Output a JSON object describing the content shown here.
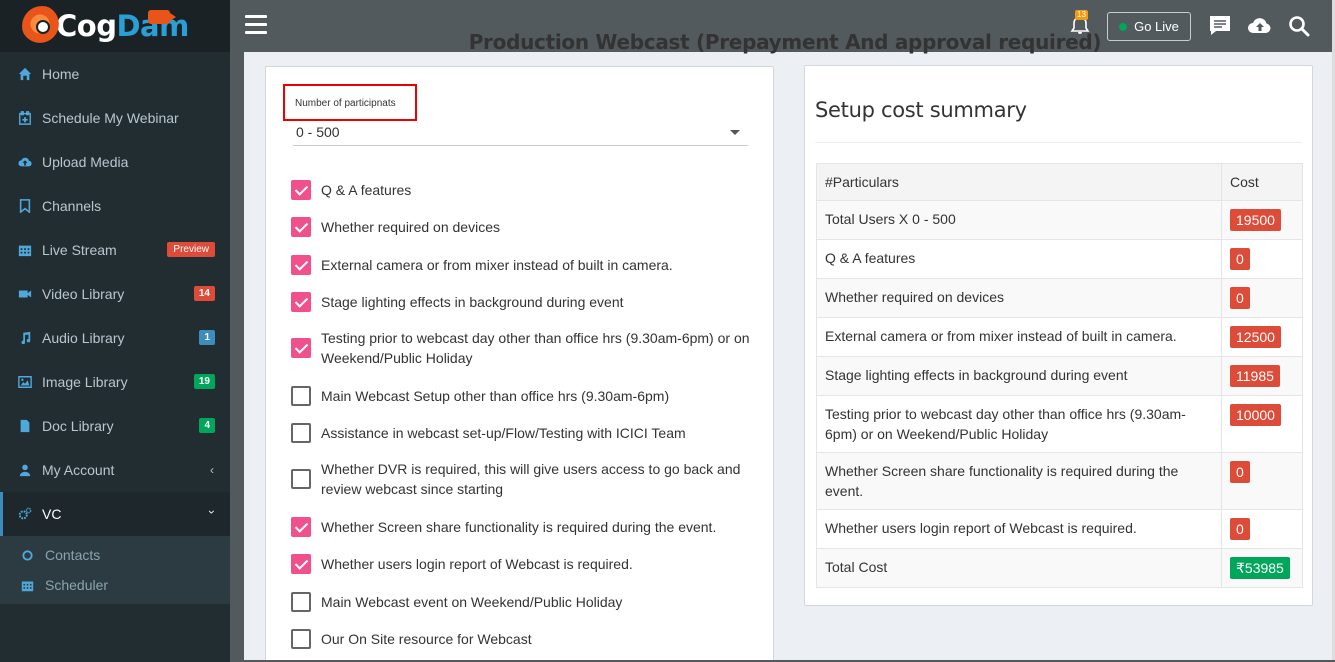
{
  "app": {
    "logo_part1": "Cog",
    "logo_part2": "Dam"
  },
  "sidebar": {
    "items": [
      {
        "label": "Home",
        "icon": "home-icon"
      },
      {
        "label": "Schedule My Webinar",
        "icon": "calendar-plus-icon"
      },
      {
        "label": "Upload Media",
        "icon": "cloud-upload-icon"
      },
      {
        "label": "Channels",
        "icon": "bookmark-icon"
      },
      {
        "label": "Live Stream",
        "icon": "calendar-icon",
        "badge": "Preview"
      },
      {
        "label": "Video Library",
        "icon": "video-camera-icon",
        "badge": "14"
      },
      {
        "label": "Audio Library",
        "icon": "music-icon",
        "badge": "1"
      },
      {
        "label": "Image Library",
        "icon": "image-icon",
        "badge": "19"
      },
      {
        "label": "Doc Library",
        "icon": "document-icon",
        "badge": "4"
      },
      {
        "label": "My Account",
        "icon": "user-icon"
      },
      {
        "label": "VC",
        "icon": "cogs-icon"
      }
    ],
    "vc_submenu": [
      {
        "label": "Contacts",
        "icon": "circle-icon"
      },
      {
        "label": "Scheduler",
        "icon": "calendar-icon"
      }
    ]
  },
  "topbar": {
    "notification_count": "13",
    "go_live_label": "Go Live"
  },
  "page": {
    "title": "Production Webcast (Prepayment And approval required)"
  },
  "form": {
    "participants_label": "Number of participnats",
    "participants_value": "0 - 500",
    "options": [
      {
        "label": "Q & A features",
        "checked": true
      },
      {
        "label": "Whether required on devices",
        "checked": true
      },
      {
        "label": "External camera or from mixer instead of built in camera.",
        "checked": true
      },
      {
        "label": "Stage lighting effects in background during event",
        "checked": true
      },
      {
        "label": "Testing prior to  webcast day  other than office hrs (9.30am-6pm) or on  Weekend/Public Holiday",
        "checked": true
      },
      {
        "label": "Main Webcast Setup other than office hrs (9.30am-6pm)",
        "checked": false
      },
      {
        "label": "Assistance in webcast set-up/Flow/Testing with ICICI Team",
        "checked": false
      },
      {
        "label": "Whether DVR is required, this will give users access to go back and review webcast since starting",
        "checked": false
      },
      {
        "label": "Whether Screen share functionality is required during the event.",
        "checked": true
      },
      {
        "label": "Whether users login report of Webcast   is required.",
        "checked": true
      },
      {
        "label": "Main Webcast event on Weekend/Public Holiday",
        "checked": false
      },
      {
        "label": "Our On Site resource for Webcast",
        "checked": false
      }
    ]
  },
  "summary": {
    "title": "Setup cost summary",
    "col_particulars": "#Particulars",
    "col_cost": "Cost",
    "rows": [
      {
        "label": "Total Users X 0 - 500",
        "cost": "19500"
      },
      {
        "label": "Q & A features",
        "cost": "0"
      },
      {
        "label": "Whether required on devices",
        "cost": "0"
      },
      {
        "label": "External camera or from mixer instead of built in camera.",
        "cost": "12500"
      },
      {
        "label": "Stage lighting effects in background during event",
        "cost": "11985"
      },
      {
        "label": "Testing prior to  webcast day  other than office hrs (9.30am-6pm) or on  Weekend/Public Holiday",
        "cost": "10000"
      },
      {
        "label": "Whether Screen share functionality is required during the event.",
        "cost": "0"
      },
      {
        "label": "Whether users login report of Webcast   is required.",
        "cost": "0"
      }
    ],
    "total_label": "Total Cost",
    "total_value": "₹53985"
  },
  "colors": {
    "sidebar_bg": "#222d32",
    "topbar_bg": "#525a5e",
    "checkbox_checked": "#f0508c",
    "cost_badge": "#dd4b39",
    "total_badge": "#00a65a"
  }
}
